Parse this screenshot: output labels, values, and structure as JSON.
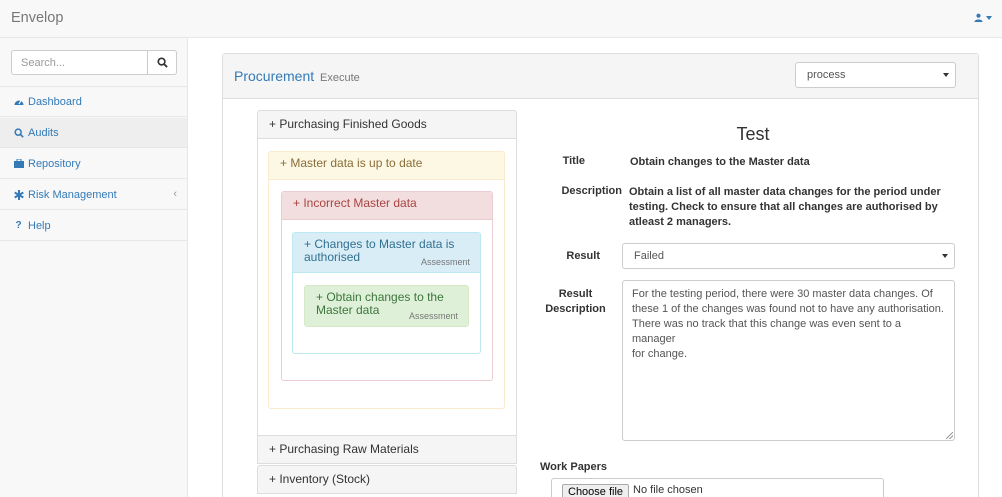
{
  "app": {
    "brand": "Envelop"
  },
  "sidebar": {
    "search_placeholder": "Search...",
    "items": [
      {
        "label": "Dashboard",
        "icon": "dashboard-icon"
      },
      {
        "label": "Audits",
        "icon": "search-icon",
        "active": true
      },
      {
        "label": "Repository",
        "icon": "briefcase-icon"
      },
      {
        "label": "Risk Management",
        "icon": "asterisk-icon",
        "has_children": true
      },
      {
        "label": "Help",
        "icon": "question-icon"
      }
    ]
  },
  "panel": {
    "title": "Procurement",
    "subtitle": "Execute",
    "mode_select": "process"
  },
  "tree": {
    "sections": [
      {
        "label": "+ Purchasing Finished Goods"
      },
      {
        "label": "+ Purchasing Raw Materials"
      },
      {
        "label": "+ Inventory (Stock)"
      }
    ],
    "nodes": [
      {
        "label": "+ Master data is up to date",
        "tag": ""
      },
      {
        "label": "+ Incorrect Master data",
        "tag": ""
      },
      {
        "label_line1": "+ Changes to Master data is",
        "label_line2": "authorised",
        "tag": "Assessment"
      },
      {
        "label_line1": "+ Obtain changes to the",
        "label_line2": "Master data",
        "tag": "Assessment"
      }
    ]
  },
  "detail": {
    "heading": "Test",
    "title_label": "Title",
    "title_value": "Obtain changes to the Master data",
    "description_label": "Description",
    "description_lines": [
      "Obtain a list of all master data changes for the period under",
      "testing. Check to ensure that all changes are authorised by",
      "atleast 2 managers."
    ],
    "result_label": "Result",
    "result_value": "Failed",
    "result_description_label_1": "Result",
    "result_description_label_2": "Description",
    "result_description_lines": [
      "For the testing period, there were 30 master data changes. Of",
      "these 1 of the changes was found not to have any authorisation.",
      "There was no track that this change was even sent to a manager",
      "for change."
    ],
    "work_papers_label": "Work Papers",
    "file_button": "Choose file",
    "file_status": "No file chosen"
  },
  "colors": {
    "link": "#337ab7",
    "warning_bg": "#fcf8e3",
    "danger_bg": "#f2dede",
    "info_bg": "#d9edf7",
    "success_bg": "#dff0d8"
  }
}
